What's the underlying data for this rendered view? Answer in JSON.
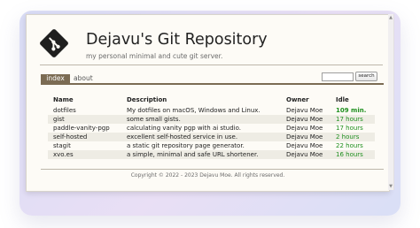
{
  "header": {
    "title": "Dejavu's Git Repository",
    "subtitle": "my personal minimal and cute git server.",
    "logo_icon": "git-logo-icon"
  },
  "nav": {
    "tabs": [
      {
        "label": "index",
        "active": true
      },
      {
        "label": "about",
        "active": false
      }
    ]
  },
  "search": {
    "value": "",
    "button_label": "search"
  },
  "table": {
    "columns": [
      "Name",
      "Description",
      "Owner",
      "Idle"
    ],
    "rows": [
      {
        "name": "dotfiles",
        "description": "My dotfiles on macOS, Windows and Linux.",
        "owner": "Dejavu Moe",
        "idle": "109 min."
      },
      {
        "name": "gist",
        "description": "some small gists.",
        "owner": "Dejavu Moe",
        "idle": "17 hours"
      },
      {
        "name": "paddle-vanity-pgp",
        "description": "calculating vanity pgp with ai studio.",
        "owner": "Dejavu Moe",
        "idle": "17 hours"
      },
      {
        "name": "self-hosted",
        "description": "excellent self-hosted service in use.",
        "owner": "Dejavu Moe",
        "idle": "2 hours"
      },
      {
        "name": "stagit",
        "description": "a static git repository page generator.",
        "owner": "Dejavu Moe",
        "idle": "22 hours"
      },
      {
        "name": "xvo.es",
        "description": "a simple, minimal and safe URL shortener.",
        "owner": "Dejavu Moe",
        "idle": "16 hours"
      }
    ]
  },
  "footer": {
    "text": "Copyright © 2022 - 2023 Dejavu Moe. All rights reserved."
  },
  "colors": {
    "accent": "#7b6b53",
    "idle_green": "#1f8f1f",
    "page_bg": "#fdfbf6",
    "row_alt": "#eeece4"
  }
}
